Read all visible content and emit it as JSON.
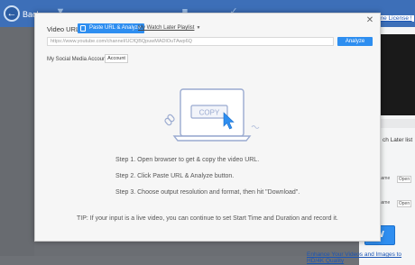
{
  "background": {
    "back_label": "Back",
    "license_link": "Lifetime License !",
    "watch_later_partial": "ch Later list",
    "open_labels": [
      "Open",
      "Open"
    ],
    "rename_labels": [
      "name",
      "name"
    ],
    "download_label": "W",
    "enhance_link": "Enhance Your Videos and Images to HD/4K Quality"
  },
  "dialog": {
    "close_glyph": "✕",
    "url_label": "Video URL:",
    "paste_button": "Paste URL & Analyze",
    "watch_later_tab": "My Watch Later Playlist",
    "url_value": "https://www.youtube.com/channel/UCfQBQpuwMADlOuTAwp6Q",
    "analyze_button": "Analyze",
    "social_label": "My Social Media Account",
    "account_button": "Account",
    "illustration_text": "COPY",
    "steps": [
      "Step 1. Open browser to get & copy the video URL.",
      "Step 2. Click Paste URL & Analyze button.",
      "Step 3. Choose output resolution and format, then hit \"Download\"."
    ],
    "tip": "TIP: If your input is a live video, you can continue to set Start Time and Duration and record it."
  },
  "colors": {
    "accent": "#2e8ef0",
    "header": "#3d6fb8",
    "overlay": "#6b6e73",
    "illustration": "#9aaad0"
  }
}
